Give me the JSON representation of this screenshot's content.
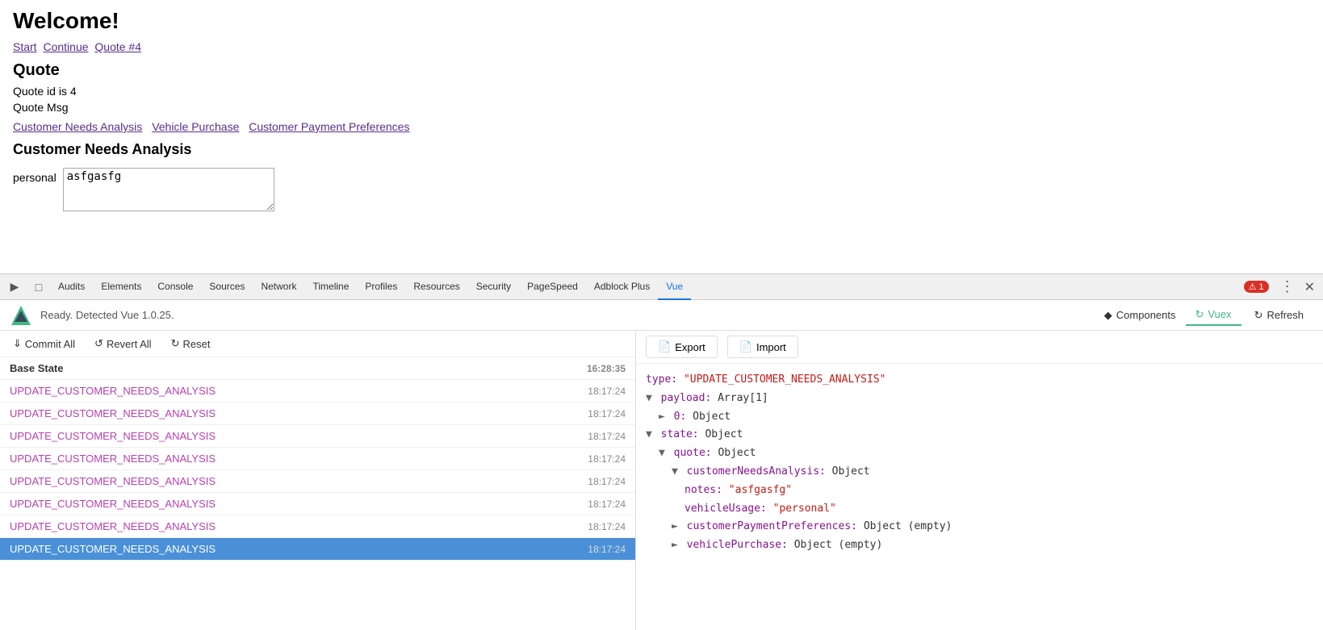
{
  "page": {
    "title": "Welcome!",
    "breadcrumb": {
      "links": [
        "Start",
        "Continue",
        "Quote #4"
      ]
    },
    "quote_section": {
      "heading": "Quote",
      "id_label": "Quote id is 4",
      "msg_label": "Quote Msg"
    },
    "page_links": [
      "Customer Needs Analysis",
      "Vehicle Purchase",
      "Customer Payment Preferences"
    ],
    "cna_heading": "Customer Needs Analysis",
    "form": {
      "label": "personal",
      "textarea_value": "asfgasfg"
    }
  },
  "devtools": {
    "tabs": [
      "Audits",
      "Elements",
      "Console",
      "Sources",
      "Network",
      "Timeline",
      "Profiles",
      "Resources",
      "Security",
      "PageSpeed",
      "Adblock Plus",
      "Vue"
    ],
    "active_tab": "Vue",
    "error_count": "1",
    "vue_bar": {
      "ready_text": "Ready. Detected Vue 1.0.25.",
      "components_label": "Components",
      "vuex_label": "Vuex",
      "refresh_label": "Refresh"
    },
    "action_toolbar": {
      "commit_all": "Commit All",
      "revert_all": "Revert All",
      "reset": "Reset"
    },
    "detail_toolbar": {
      "export": "Export",
      "import": "Import"
    },
    "vuex_entries": [
      {
        "name": "Base State",
        "time": "16:28:35",
        "is_base": true
      },
      {
        "name": "UPDATE_CUSTOMER_NEEDS_ANALYSIS",
        "time": "18:17:24"
      },
      {
        "name": "UPDATE_CUSTOMER_NEEDS_ANALYSIS",
        "time": "18:17:24"
      },
      {
        "name": "UPDATE_CUSTOMER_NEEDS_ANALYSIS",
        "time": "18:17:24"
      },
      {
        "name": "UPDATE_CUSTOMER_NEEDS_ANALYSIS",
        "time": "18:17:24"
      },
      {
        "name": "UPDATE_CUSTOMER_NEEDS_ANALYSIS",
        "time": "18:17:24"
      },
      {
        "name": "UPDATE_CUSTOMER_NEEDS_ANALYSIS",
        "time": "18:17:24"
      },
      {
        "name": "UPDATE_CUSTOMER_NEEDS_ANALYSIS",
        "time": "18:17:24"
      },
      {
        "name": "UPDATE_CUSTOMER_NEEDS_ANALYSIS",
        "time": "18:17:24",
        "active": true
      }
    ],
    "state_detail": {
      "type_key": "type:",
      "type_value": "\"UPDATE_CUSTOMER_NEEDS_ANALYSIS\"",
      "payload_label": "payload: Array[1]",
      "item_0": "0: Object",
      "state_label": "state: Object",
      "quote_label": "quote: Object",
      "cna_label": "customerNeedsAnalysis: Object",
      "notes_key": "notes:",
      "notes_value": "\"asfgasfg\"",
      "vehicle_usage_key": "vehicleUsage:",
      "vehicle_usage_value": "\"personal\"",
      "cpp_label": "customerPaymentPreferences: Object (empty)",
      "vp_label": "vehiclePurchase: Object (empty)"
    }
  }
}
